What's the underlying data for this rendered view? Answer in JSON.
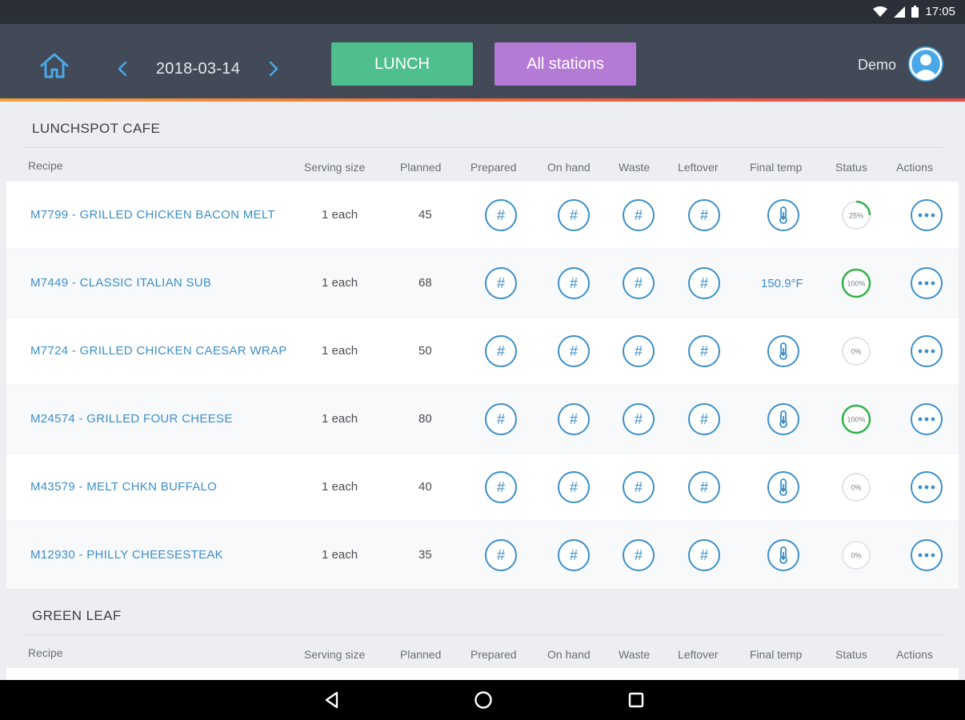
{
  "statusbar": {
    "time": "17:05"
  },
  "header": {
    "date": "2018-03-14",
    "meal_button": "LUNCH",
    "stations_button": "All stations",
    "user_name": "Demo"
  },
  "columns": {
    "recipe": "Recipe",
    "serving_size": "Serving size",
    "planned": "Planned",
    "prepared": "Prepared",
    "on_hand": "On hand",
    "waste": "Waste",
    "leftover": "Leftover",
    "final_temp": "Final temp",
    "status": "Status",
    "actions": "Actions"
  },
  "sections": [
    {
      "title": "LUNCHSPOT CAFE",
      "rows": [
        {
          "recipe": "M7799 - GRILLED CHICKEN BACON MELT",
          "serving": "1 each",
          "planned": "45",
          "final_temp": "",
          "status": "25%",
          "status_value": 25
        },
        {
          "recipe": "M7449 - CLASSIC ITALIAN SUB",
          "serving": "1 each",
          "planned": "68",
          "final_temp": "150.9°F",
          "status": "100%",
          "status_value": 100
        },
        {
          "recipe": "M7724 - GRILLED CHICKEN CAESAR WRAP",
          "serving": "1 each",
          "planned": "50",
          "final_temp": "",
          "status": "0%",
          "status_value": 0
        },
        {
          "recipe": "M24574 - GRILLED FOUR CHEESE",
          "serving": "1 each",
          "planned": "80",
          "final_temp": "",
          "status": "100%",
          "status_value": 100
        },
        {
          "recipe": "M43579 - MELT CHKN BUFFALO",
          "serving": "1 each",
          "planned": "40",
          "final_temp": "",
          "status": "0%",
          "status_value": 0
        },
        {
          "recipe": "M12930 - PHILLY CHEESESTEAK",
          "serving": "1 each",
          "planned": "35",
          "final_temp": "",
          "status": "0%",
          "status_value": 0
        }
      ]
    },
    {
      "title": "GREEN LEAF",
      "rows": []
    }
  ],
  "icons": {
    "count_button": "#",
    "home": "home-icon",
    "thermometer": "thermometer-icon",
    "more": "more-icon"
  },
  "colors": {
    "header_bg": "#414a56",
    "lunch_green": "#4fc08d",
    "stations_purple": "#b57ad6",
    "link_blue": "#3d8fc9",
    "status_green": "#2fb34a"
  }
}
